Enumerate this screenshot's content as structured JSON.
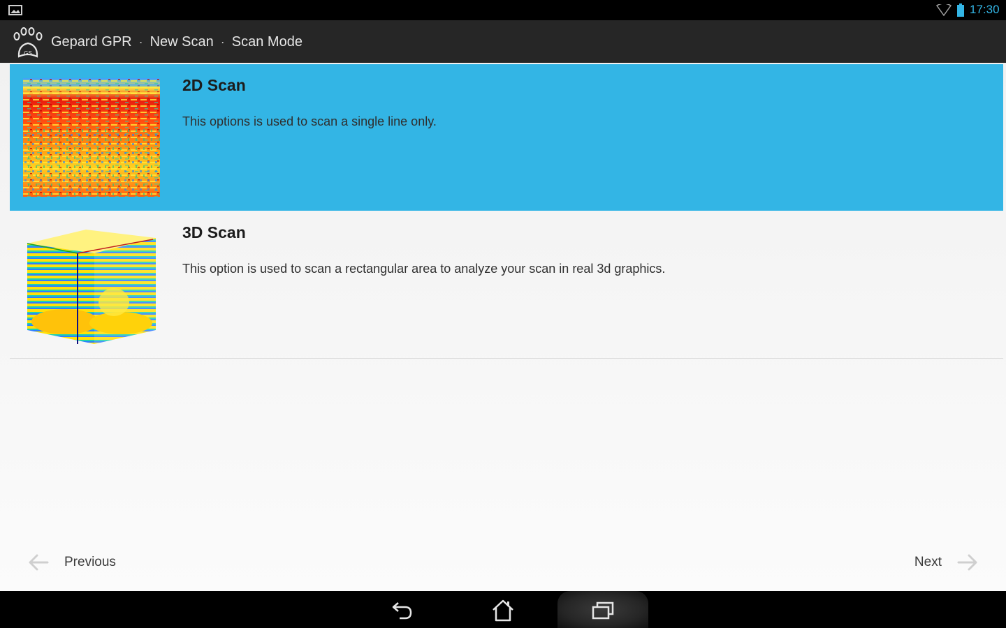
{
  "status_bar": {
    "time": "17:30",
    "icons": [
      "notification-image-icon",
      "wifi-icon",
      "battery-icon"
    ],
    "clock_color": "#33b5e5"
  },
  "action_bar": {
    "logo_icon": "paw-logo-icon",
    "breadcrumb": [
      "Gepard GPR",
      "New Scan",
      "Scan Mode"
    ],
    "separator": "·"
  },
  "options": [
    {
      "title": "2D Scan",
      "description": "This options is used to scan a single line only.",
      "selected": true,
      "thumbnail": "radargram-thumbnail"
    },
    {
      "title": "3D Scan",
      "description": "This option is used to scan a rectangular area to analyze your scan in real 3d graphics.",
      "selected": false,
      "thumbnail": "3d-cube-thumbnail"
    }
  ],
  "navigation": {
    "previous_label": "Previous",
    "next_label": "Next"
  },
  "system_nav": {
    "buttons": [
      "back-icon",
      "home-icon",
      "recents-icon"
    ]
  },
  "colors": {
    "accent": "#33b5e5",
    "action_bar": "#262626",
    "status_bar": "#000000"
  }
}
